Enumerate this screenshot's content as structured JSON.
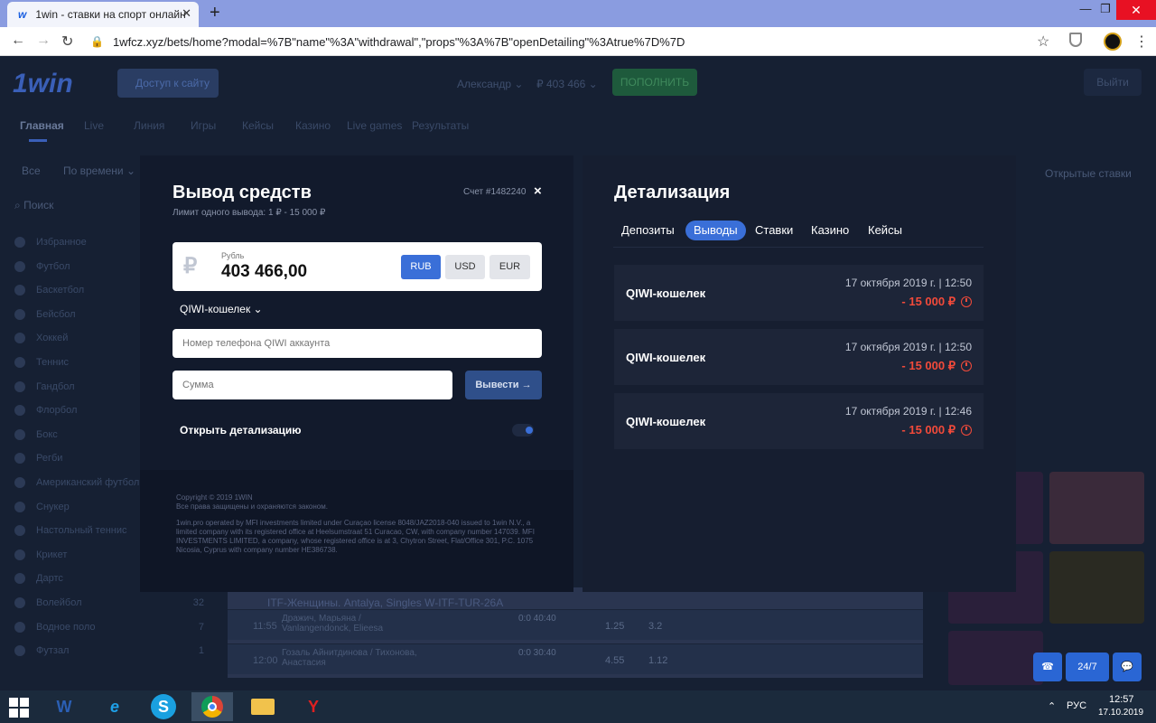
{
  "browser": {
    "tab_title": "1win - ставки на спорт онлайн",
    "tab_icon": "w",
    "url": "1wfcz.xyz/bets/home?modal=%7B\"name\"%3A\"withdrawal\",\"props\"%3A%7B\"openDetailing\"%3Atrue%7D%7D"
  },
  "site": {
    "logo": "1win",
    "access_button": "Доступ к сайту",
    "user": "Александр ⌄",
    "balance": "₽ 403 466 ⌄",
    "topup": "ПОПОЛНИТЬ",
    "logout": "Выйти",
    "nav": [
      "Главная",
      "Live",
      "Линия",
      "Игры",
      "Кейсы",
      "Казино",
      "Live games",
      "Результаты"
    ],
    "filter_all": "Все",
    "filter_time": "По времени ⌄",
    "search": "Поиск",
    "open_bets": "Открытые ставки",
    "sidebar": [
      {
        "label": "Избранное",
        "count": ""
      },
      {
        "label": "Футбол",
        "count": ""
      },
      {
        "label": "Баскетбол",
        "count": ""
      },
      {
        "label": "Бейсбол",
        "count": ""
      },
      {
        "label": "Хоккей",
        "count": ""
      },
      {
        "label": "Теннис",
        "count": ""
      },
      {
        "label": "Гандбол",
        "count": ""
      },
      {
        "label": "Флорбол",
        "count": ""
      },
      {
        "label": "Бокс",
        "count": ""
      },
      {
        "label": "Регби",
        "count": ""
      },
      {
        "label": "Американский футбол",
        "count": ""
      },
      {
        "label": "Снукер",
        "count": ""
      },
      {
        "label": "Настольный теннис",
        "count": ""
      },
      {
        "label": "Крикет",
        "count": ""
      },
      {
        "label": "Дартс",
        "count": ""
      },
      {
        "label": "Волейбол",
        "count": "32"
      },
      {
        "label": "Водное поло",
        "count": "7"
      },
      {
        "label": "Футзал",
        "count": "1"
      }
    ],
    "table_header": "ITF-Женщины. Antalya, Singles W-ITF-TUR-26A",
    "matches": [
      {
        "time": "11:55",
        "teams": "Дражич, Марьяна / Vanlangendonck, Elieesa",
        "score": "0:0 40:40",
        "c1": "1.25",
        "c2": "3.2"
      },
      {
        "time": "12:00",
        "teams": "Гозаль Айнитдинова / Тихонова, Анастасия",
        "score": "0:0 30:40",
        "c1": "4.55",
        "c2": "1.12"
      }
    ],
    "support": {
      "phone": "☎",
      "hours": "24/7",
      "chat": "💬"
    }
  },
  "withdrawal": {
    "title": "Вывод средств",
    "limit": "Лимит одного вывода: 1 ₽ - 15 000 ₽",
    "account": "Счет #1482240",
    "close": "×",
    "currency_label": "Рубль",
    "currency_symbol": "₽",
    "amount": "403 466,00",
    "currencies": [
      "RUB",
      "USD",
      "EUR"
    ],
    "method": "QIWI-кошелек ⌄",
    "phone_placeholder": "Номер телефона QIWI аккаунта",
    "sum_placeholder": "Сумма",
    "withdraw_button": "Вывести →",
    "detail_toggle_label": "Открыть детализацию",
    "footer_copyright": "Copyright © 2019 1WIN",
    "footer_rights": "Все права защищены и охраняются законом.",
    "footer_legal": "1win.pro operated by MFI investments limited under Curaçao license 8048/JAZ2018-040 issued to 1win N.V., a limited company with its registered office at Heelsumstraat 51 Curacao, CW, with company number 147039. MFI INVESTMENTS LIMITED, a company, whose registered office is at 3, Chytron Street, Flat/Office 301, P.C. 1075 Nicosia, Cyprus with company number HE386738."
  },
  "detailing": {
    "title": "Детализация",
    "tabs": [
      "Депозиты",
      "Выводы",
      "Ставки",
      "Казино",
      "Кейсы"
    ],
    "active_tab": "Выводы",
    "rows": [
      {
        "method": "QIWI-кошелек",
        "date": "17 октября 2019 г. | 12:50",
        "amount": "- 15 000 ₽"
      },
      {
        "method": "QIWI-кошелек",
        "date": "17 октября 2019 г. | 12:50",
        "amount": "- 15 000 ₽"
      },
      {
        "method": "QIWI-кошелек",
        "date": "17 октября 2019 г. | 12:46",
        "amount": "- 15 000 ₽"
      }
    ]
  },
  "taskbar": {
    "lang": "РУС",
    "time": "12:57",
    "date": "17.10.2019",
    "apps": [
      "W",
      "e",
      "S",
      "chrome",
      "folder",
      "Y"
    ]
  },
  "colors": {
    "accent": "#3a6fd8",
    "negative": "#f24a3a",
    "modal_bg": "#121a2c"
  }
}
